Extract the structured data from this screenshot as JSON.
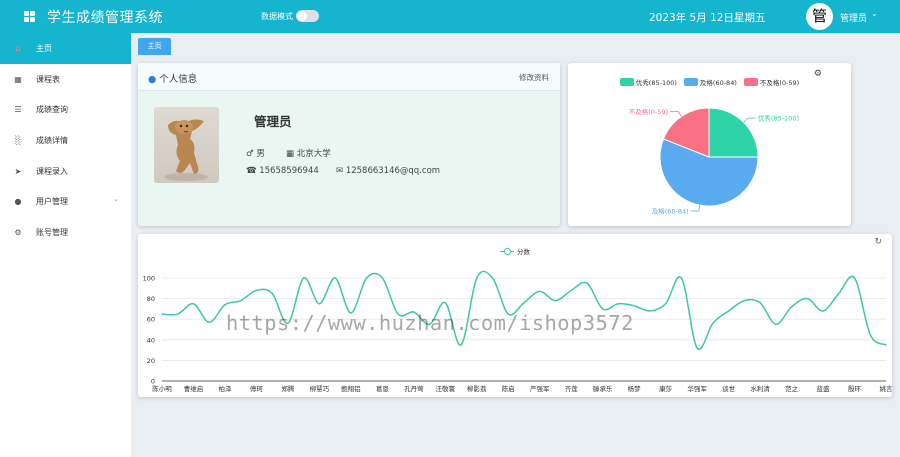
{
  "header": {
    "app_title": "学生成绩管理系统",
    "dark_mode_label": "数据模式",
    "date": "2023年 5月 12日",
    "weekday": "星期五",
    "avatar_char": "管",
    "user_name": "管理员",
    "colors": {
      "bar": "#15b4cf"
    }
  },
  "sidebar": {
    "items": [
      {
        "label": "主页",
        "icon": "home-icon",
        "active": true
      },
      {
        "label": "课程表",
        "icon": "grid-icon"
      },
      {
        "label": "成绩查询",
        "icon": "list-icon"
      },
      {
        "label": "成绩详情",
        "icon": "bar-chart-icon"
      },
      {
        "label": "课程录入",
        "icon": "send-icon"
      },
      {
        "label": "用户管理",
        "icon": "user-icon",
        "has_submenu": true
      },
      {
        "label": "账号管理",
        "icon": "gear-icon"
      }
    ]
  },
  "tabs": [
    {
      "label": "主页"
    }
  ],
  "profile": {
    "title": "个人信息",
    "edit_link": "修改资料",
    "name": "管理员",
    "gender": "男",
    "school": "北京大学",
    "phone": "15658596944",
    "email": "1258663146@qq.com"
  },
  "chart_data": [
    {
      "type": "pie",
      "slices": [
        {
          "name": "优秀(85-100)",
          "value": 25,
          "color": "#2fd3a8"
        },
        {
          "name": "及格(60-84)",
          "value": 56,
          "color": "#59aaee"
        },
        {
          "name": "不及格(0-59)",
          "value": 19,
          "color": "#f87185"
        }
      ],
      "legend_position": "top"
    },
    {
      "type": "line",
      "series": [
        {
          "name": "分数",
          "color": "#3fc6a8",
          "values": [
            65,
            65,
            75,
            57,
            74,
            78,
            88,
            85,
            56,
            100,
            75,
            100,
            66,
            100,
            100,
            65,
            67,
            55,
            76,
            35,
            100,
            100,
            65,
            76,
            87,
            78,
            88,
            95,
            70,
            75,
            73,
            68,
            75,
            100,
            32,
            56,
            68,
            78,
            76,
            55,
            72,
            80,
            68,
            85,
            100,
            45,
            35
          ]
        }
      ],
      "categories": [
        "陈小明",
        "",
        "曹维启",
        "",
        "柏泽",
        "",
        "傅珂",
        "",
        "郑腾",
        "",
        "柳慧巧",
        "",
        "鲍翔铝",
        "",
        "葛恩",
        "",
        "孔丹莺",
        "",
        "汪敬寰",
        "",
        "柳影荔",
        "",
        "陈启",
        "",
        "严强军",
        "",
        "齐莲",
        "",
        "滕承乐",
        "",
        "杨梦",
        "",
        "康莎",
        "",
        "华强军",
        "",
        "谈世",
        "",
        "水利清",
        "",
        "范之",
        "",
        "蓝盛",
        "",
        "殷环",
        "",
        "姚言",
        "",
        "史霓"
      ],
      "ylim": [
        0,
        100
      ],
      "yticks": [
        0,
        20,
        40,
        60,
        80,
        100
      ],
      "grid": true,
      "legend_position": "top-center"
    }
  ],
  "watermark": "https://www.huzhan.com/ishop3572"
}
